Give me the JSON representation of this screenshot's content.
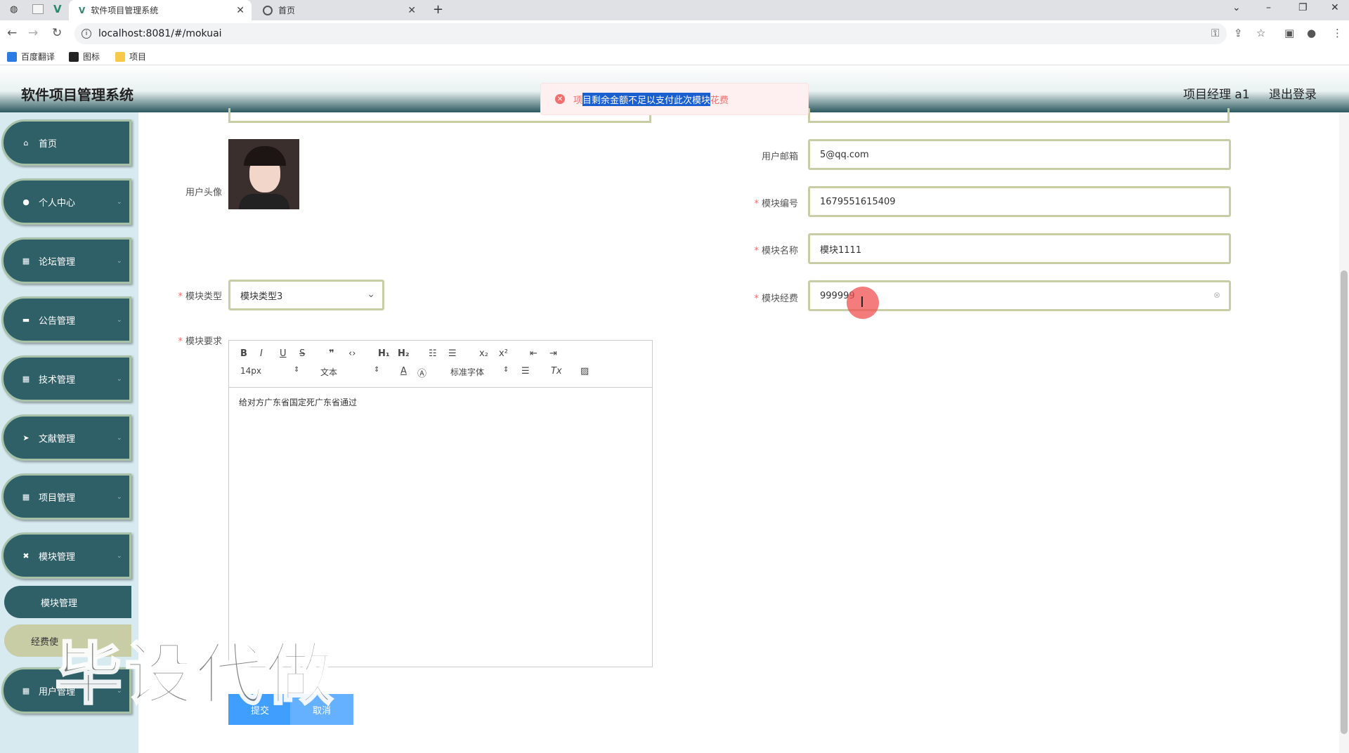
{
  "browser": {
    "tabs": [
      {
        "title": "软件项目管理系统",
        "active": true
      },
      {
        "title": "首页",
        "active": false
      }
    ],
    "url": "localhost:8081/#/mokuai",
    "bookmarks": [
      "百度翻译",
      "图标",
      "项目"
    ]
  },
  "header": {
    "title": "软件项目管理系统",
    "user": "项目经理 a1",
    "logout": "退出登录"
  },
  "sidebar": {
    "items": [
      {
        "label": "首页",
        "icon": "home-icon"
      },
      {
        "label": "个人中心",
        "icon": "person-icon"
      },
      {
        "label": "论坛管理",
        "icon": "grid-icon"
      },
      {
        "label": "公告管理",
        "icon": "monitor-icon"
      },
      {
        "label": "技术管理",
        "icon": "grid-icon"
      },
      {
        "label": "文献管理",
        "icon": "send-icon"
      },
      {
        "label": "项目管理",
        "icon": "grid-icon"
      },
      {
        "label": "模块管理",
        "icon": "film-icon"
      },
      {
        "label": "用户管理",
        "icon": "grid-icon"
      }
    ],
    "subitems": [
      "模块管理",
      "经费使"
    ]
  },
  "toast": {
    "prefix": "项",
    "highlighted": "目剩余金额不足以支付此次模块",
    "suffix": "花费"
  },
  "form": {
    "avatar_label": "用户头像",
    "email_label": "用户邮箱",
    "email_value": "5@qq.com",
    "module_no_label": "模块编号",
    "module_no_value": "1679551615409",
    "module_name_label": "模块名称",
    "module_name_value": "模块1111",
    "module_type_label": "模块类型",
    "module_type_value": "模块类型3",
    "module_fee_label": "模块经费",
    "module_fee_value": "999999",
    "requirement_label": "模块要求",
    "editor_content": "给对方广东省国定死广东省通过",
    "toolbar": {
      "font_size": "14px",
      "text_type": "文本",
      "font": "标准字体"
    },
    "submit": "提交",
    "cancel": "取消"
  },
  "watermark": "毕设代做"
}
